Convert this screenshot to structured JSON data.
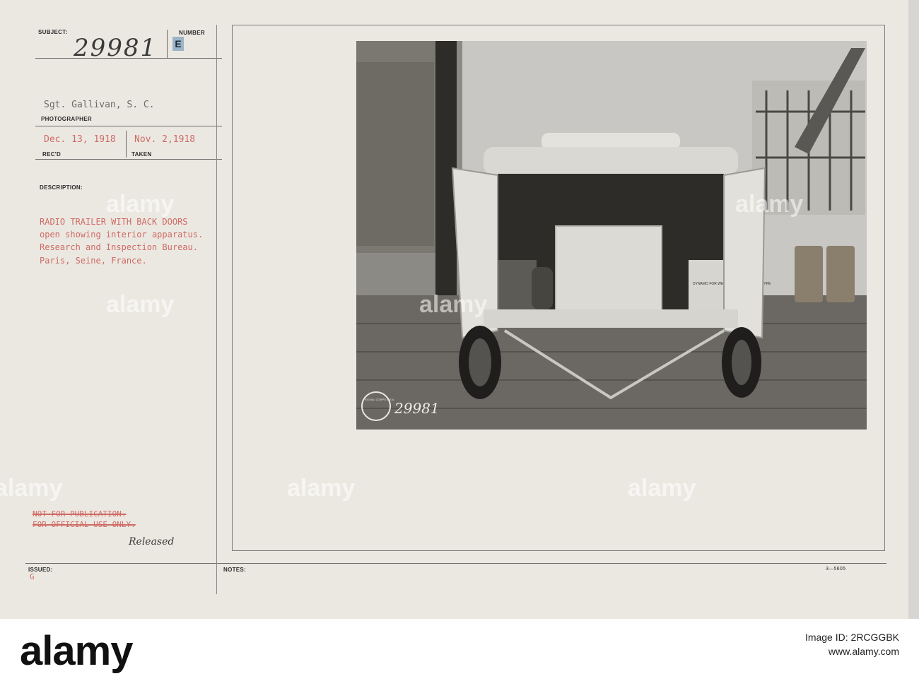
{
  "card": {
    "labels": {
      "subject": "SUBJECT:",
      "number": "NUMBER",
      "photographer": "PHOTOGRAPHER",
      "recd": "REC'D",
      "taken": "TAKEN",
      "description": "DESCRIPTION:",
      "issued": "ISSUED:",
      "notes": "NOTES:"
    },
    "subject_number": "29981",
    "number_badge": "E",
    "photographer_name": "Sgt. Gallivan, S. C.",
    "date_received": "Dec. 13, 1918",
    "date_taken": "Nov. 2,1918",
    "description_lines": [
      "RADIO TRAILER WITH BACK DOORS",
      "open showing interior apparatus.",
      "Research and Inspection Bureau.",
      "Paris, Seine, France."
    ],
    "restriction_lines": [
      "NOT FOR PUBLICATION.",
      "FOR OFFICIAL USE ONLY."
    ],
    "released_note": "Released",
    "issued_mark": "G",
    "form_number": "3—5605"
  },
  "photo": {
    "stamp_text": "SIGNAL CORPS U.S.A.",
    "photo_number": "29981",
    "crate_label": "DYNAMO FOR WESTINGHOUSE SIGNAL TYPE"
  },
  "watermark": {
    "text": "alamy"
  },
  "footer": {
    "logo": "alamy",
    "image_id_label": "Image ID:",
    "image_id": "2RCGGBK",
    "site": "www.alamy.com"
  }
}
